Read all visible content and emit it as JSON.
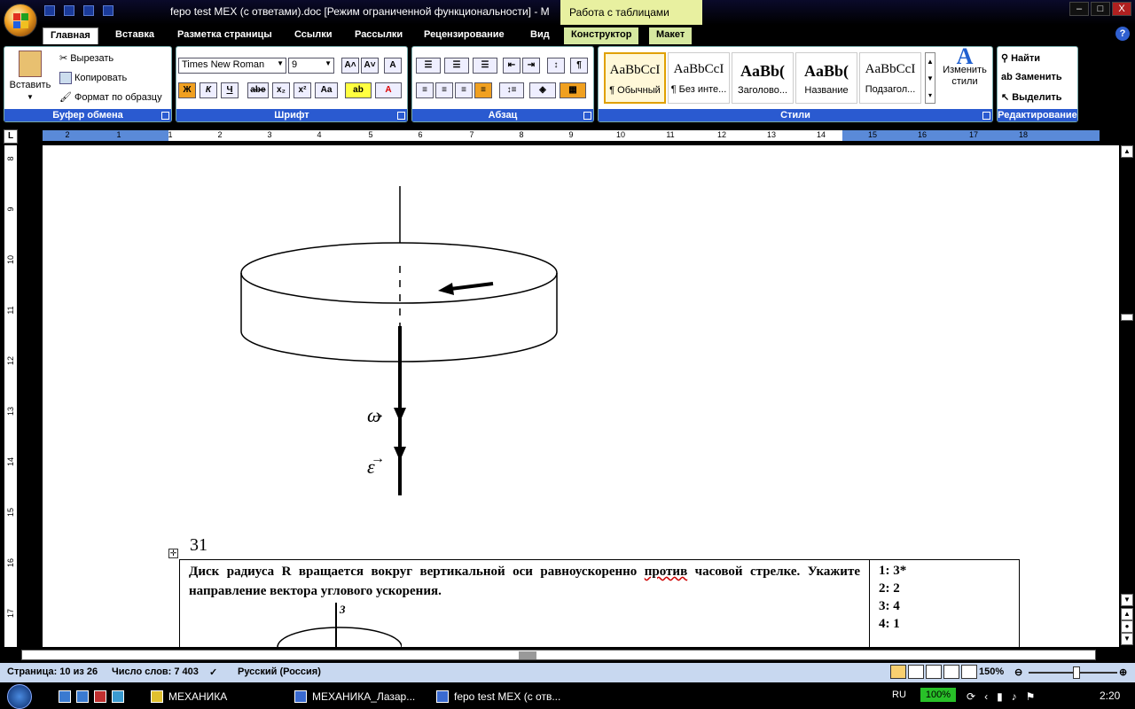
{
  "window": {
    "title": "fepo test MEX (с ответами).doc [Режим ограниченной функциональности] - M",
    "context_title": "Работа с таблицами",
    "controls": [
      "–",
      "□",
      "X"
    ]
  },
  "tabs": [
    {
      "label": "Главная",
      "active": true
    },
    {
      "label": "Вставка"
    },
    {
      "label": "Разметка страницы"
    },
    {
      "label": "Ссылки"
    },
    {
      "label": "Рассылки"
    },
    {
      "label": "Рецензирование"
    },
    {
      "label": "Вид"
    },
    {
      "label": "Конструктор",
      "context": true
    },
    {
      "label": "Макет",
      "context": true
    }
  ],
  "help_label": "?",
  "ribbon": {
    "clipboard": {
      "label": "Буфер обмена",
      "paste": "Вставить",
      "cut": "Вырезать",
      "copy": "Копировать",
      "format_painter": "Формат по образцу"
    },
    "font": {
      "label": "Шрифт",
      "font_name": "Times New Roman",
      "font_size": "9",
      "bold": "Ж",
      "italic": "К",
      "underline": "Ч",
      "strike": "abe",
      "subscript": "x₂",
      "superscript": "x²",
      "change_case": "Aa",
      "grow": "A˄",
      "shrink": "A˅",
      "clear": "A"
    },
    "paragraph": {
      "label": "Абзац",
      "show_marks": "¶"
    },
    "styles": {
      "label": "Стили",
      "items": [
        {
          "sample": "AaBbCcI",
          "name": "¶ Обычный",
          "selected": true
        },
        {
          "sample": "AaBbCcI",
          "name": "¶ Без инте..."
        },
        {
          "sample": "AaBb(",
          "name": "Заголово..."
        },
        {
          "sample": "AaBb(",
          "name": "Название"
        },
        {
          "sample": "AaBbCcI",
          "name": "Подзагол..."
        }
      ],
      "change_styles": "Изменить стили"
    },
    "editing": {
      "label": "Редактирование",
      "find": "Найти",
      "replace": "Заменить",
      "select": "Выделить"
    }
  },
  "ruler": {
    "corner": "L",
    "numbers": [
      "2",
      "1",
      "1",
      "2",
      "3",
      "4",
      "5",
      "6",
      "7",
      "8",
      "9",
      "10",
      "11",
      "12",
      "13",
      "14",
      "15",
      "16",
      "17",
      "18"
    ],
    "vertical_numbers": [
      "8",
      "9",
      "10",
      "11",
      "12",
      "13",
      "14",
      "15",
      "16",
      "17"
    ]
  },
  "figure": {
    "omega_label": "ω",
    "epsilon_label": "ε"
  },
  "question": {
    "number": "31",
    "text_before": "Диск радиуса R вращается вокруг вертикальной оси равноускоренно ",
    "text_underlined": "против",
    "text_after": " часовой стрелке. Укажите направление вектора углового ускорения.",
    "answers": [
      "1: 3*",
      "2: 2",
      "3: 4",
      "4: 1"
    ],
    "figure_label_3": "3"
  },
  "statusbar": {
    "page": "Страница: 10 из 26",
    "words": "Число слов: 7 403",
    "language": "Русский (Россия)",
    "zoom": "150%"
  },
  "taskbar": {
    "tasks": [
      "МЕХАНИКА",
      "МЕХАНИКА_Лазар...",
      "fepo test MEX (с отв..."
    ],
    "lang": "RU",
    "battery": "100%",
    "time": "2:20"
  }
}
